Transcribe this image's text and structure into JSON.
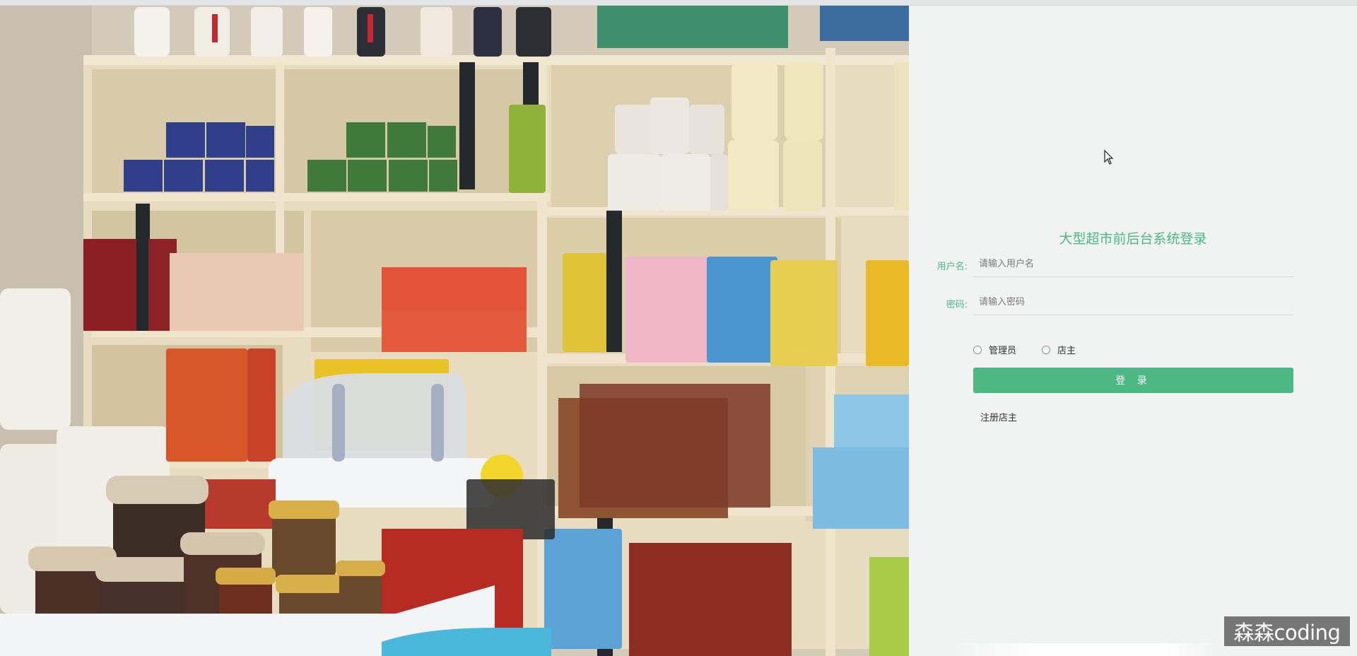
{
  "login": {
    "title": "大型超市前后台系统登录",
    "username_label": "用户名:",
    "username_placeholder": "请输入用户名",
    "password_label": "密码:",
    "password_placeholder": "请输入密码",
    "roles": [
      "管理员",
      "店主"
    ],
    "submit_label": "登 录",
    "register_label": "注册店主"
  },
  "watermark": "森森coding",
  "colors": {
    "accent": "#4cb883",
    "panel_bg": "#f1f2f2"
  }
}
